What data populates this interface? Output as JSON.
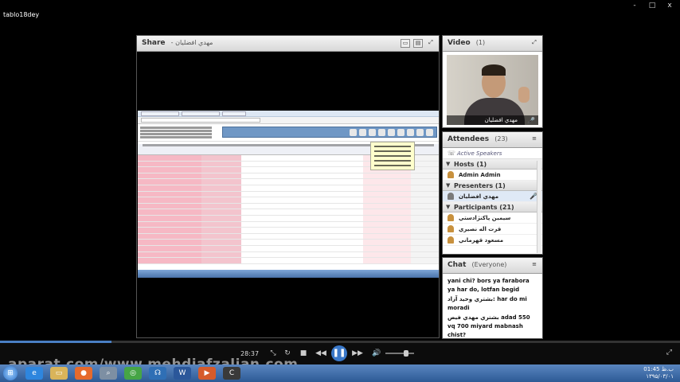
{
  "window": {
    "title": "tablo18dey",
    "minimize": "-",
    "maximize": "□",
    "close": "x"
  },
  "share": {
    "title": "Share",
    "presenter": "- مهدي افضليان"
  },
  "video": {
    "title": "Video",
    "count": "(1)",
    "name_label": "مهدي افضليان"
  },
  "attendees": {
    "title": "Attendees",
    "count": "(23)",
    "active_speakers": "Active Speakers",
    "hosts_label": "Hosts (1)",
    "host_name": "Admin Admin",
    "presenters_label": "Presenters (1)",
    "presenter_name": "مهدي افضليان",
    "participants_label": "Participants (21)",
    "participants": [
      "سيمين پاكنژادستي",
      "قرت اله نصيري",
      "مسعود قهرماني"
    ]
  },
  "chat": {
    "title": "Chat",
    "scope": "(Everyone)",
    "messages": [
      "yani chi? bors ya farabora ya har do, lotfan begid",
      "بشتري وحيد آزاد: har do mi moradi",
      "بشتري مهدي فيض adad 550 vq 700 miyard mabnash chist?"
    ]
  },
  "player": {
    "time": "28:37",
    "progress": 0.164,
    "volume": 0.72
  },
  "watermark": "aparat.com/www.mehdiafzalian.com",
  "taskbar": {
    "time": "01:45 ب.ظ",
    "date": "۱۳۹۵/۰۳/۰۱"
  },
  "icons": {
    "window": [
      "minimize-icon",
      "maximize-icon",
      "close-icon"
    ],
    "player": [
      "expand-icon",
      "refresh-icon",
      "stop-icon",
      "rewind-icon",
      "pause-icon",
      "forward-icon",
      "volume-icon",
      "fullscreen-icon"
    ]
  }
}
